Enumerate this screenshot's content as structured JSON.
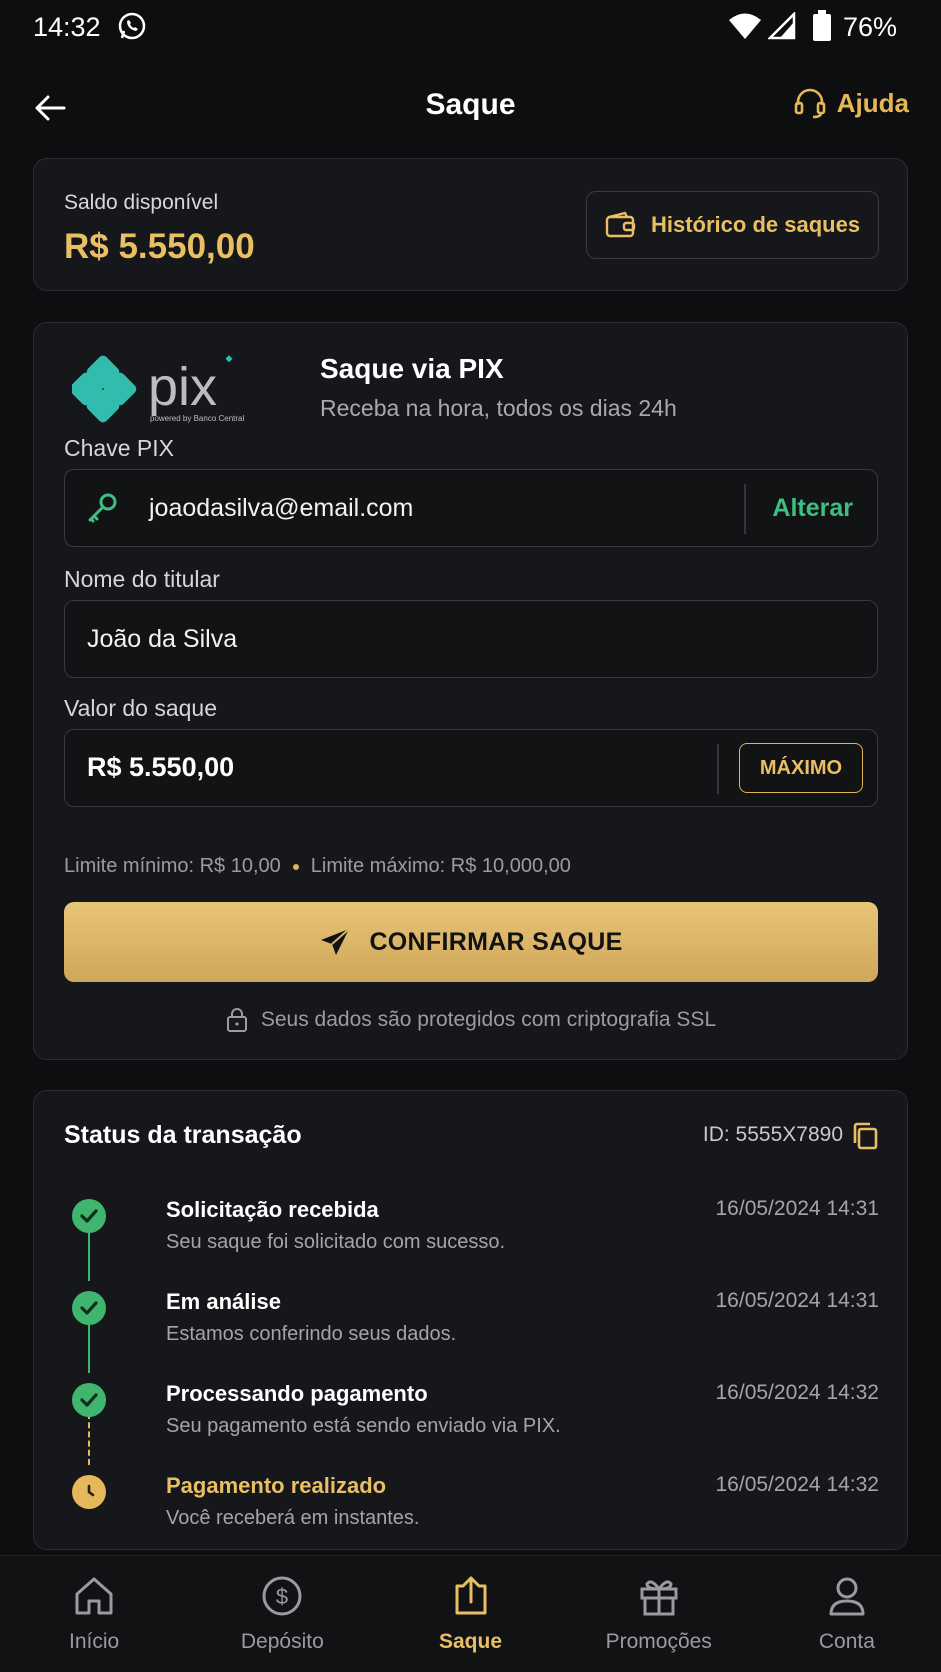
{
  "status_bar": {
    "time": "14:32",
    "battery": "76%"
  },
  "header": {
    "title": "Saque",
    "help_label": "Ajuda"
  },
  "balance": {
    "label": "Saldo disponível",
    "value": "R$ 5.550,00",
    "history_button": "Histórico de saques"
  },
  "pix": {
    "title": "Saque via PIX",
    "subtitle": "Receba na hora, todos os dias 24h",
    "logo_text": "pix",
    "logo_caption": "powered by Banco Central",
    "key_label": "Chave PIX",
    "key_value": "joaodasilva@email.com",
    "change_label": "Alterar",
    "holder_label": "Nome do titular",
    "holder_value": "João da Silva",
    "amount_label": "Valor do saque",
    "amount_value": "R$ 5.550,00",
    "max_button": "MÁXIMO",
    "limit_min": "Limite mínimo: R$ 10,00",
    "limit_max": "Limite máximo: R$ 10,000,00",
    "confirm_button": "CONFIRMAR SAQUE",
    "secure_note": "Seus dados são protegidos com criptografia SSL"
  },
  "status": {
    "title": "Status da transação",
    "id": "ID: 5555X7890",
    "steps": [
      {
        "title": "Solicitação recebida",
        "desc": "Seu saque foi solicitado com sucesso.",
        "date": "16/05/2024 14:31",
        "state": "done"
      },
      {
        "title": "Em análise",
        "desc": "Estamos conferindo seus dados.",
        "date": "16/05/2024 14:31",
        "state": "done"
      },
      {
        "title": "Processando pagamento",
        "desc": "Seu pagamento está sendo enviado via PIX.",
        "date": "16/05/2024 14:32",
        "state": "done"
      },
      {
        "title": "Pagamento realizado",
        "desc": "Você receberá em instantes.",
        "date": "16/05/2024 14:32",
        "state": "pending"
      }
    ]
  },
  "nav": {
    "items": [
      {
        "label": "Início",
        "icon": "home-icon"
      },
      {
        "label": "Depósito",
        "icon": "dollar-icon"
      },
      {
        "label": "Saque",
        "icon": "withdraw-icon",
        "active": true
      },
      {
        "label": "Promoções",
        "icon": "gift-icon"
      },
      {
        "label": "Conta",
        "icon": "user-icon"
      }
    ]
  },
  "colors": {
    "accent": "#e9bf63",
    "success": "#3fb56e",
    "background": "#0d0e10",
    "card": "#16171a"
  }
}
